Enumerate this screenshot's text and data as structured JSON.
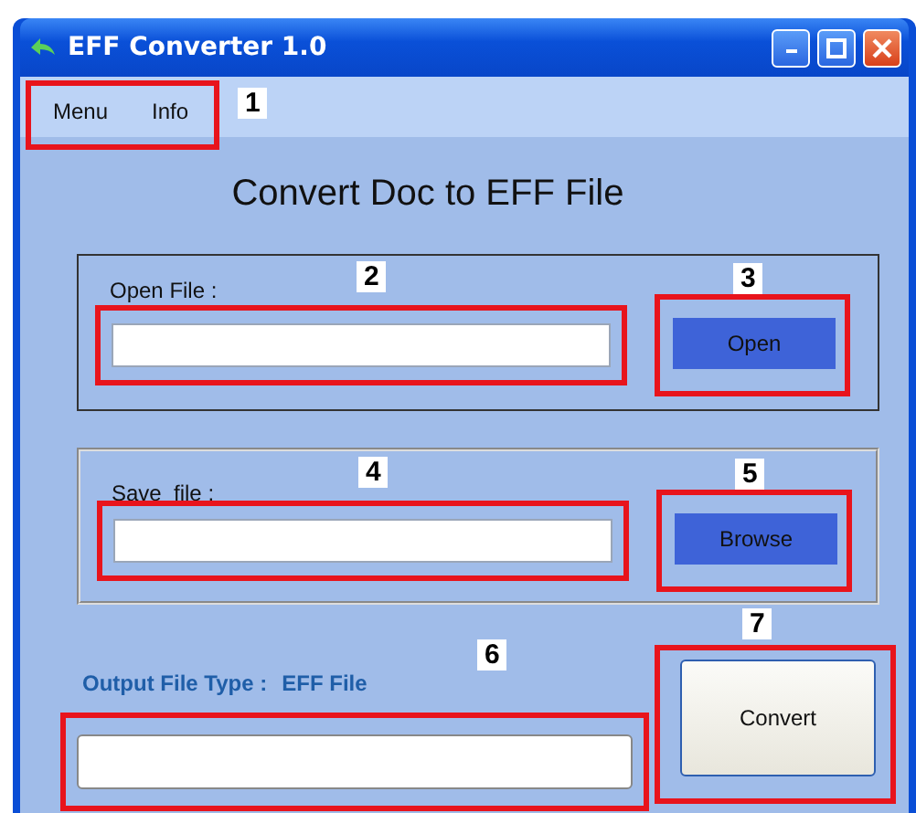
{
  "window": {
    "title": "EFF Converter 1.0"
  },
  "menu": {
    "items": [
      {
        "label": "Menu"
      },
      {
        "label": "Info"
      }
    ],
    "annotation": "1"
  },
  "heading": "Convert Doc to EFF File",
  "open_group": {
    "label": "Open File :",
    "field_annotation": "2",
    "button": "Open",
    "button_annotation": "3"
  },
  "save_group": {
    "label": "Save  file :",
    "field_annotation": "4",
    "button": "Browse",
    "button_annotation": "5"
  },
  "output": {
    "label": "Output File Type :",
    "value": "EFF File",
    "field_annotation": "6"
  },
  "convert": {
    "button": "Convert",
    "annotation": "7"
  }
}
